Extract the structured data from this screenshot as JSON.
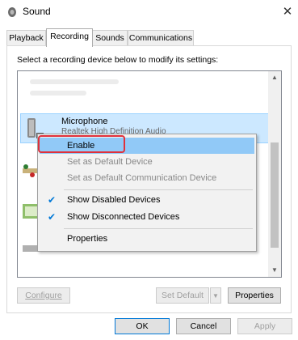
{
  "window": {
    "title": "Sound",
    "icon": "speaker-icon",
    "close": "close-icon"
  },
  "tabs": [
    {
      "label": "Playback"
    },
    {
      "label": "Recording"
    },
    {
      "label": "Sounds"
    },
    {
      "label": "Communications"
    }
  ],
  "instructions": "Select a recording device below to modify its settings:",
  "device": {
    "name": "Microphone",
    "description": "Realtek High Definition Audio"
  },
  "context_menu": {
    "enable": "Enable",
    "set_default": "Set as Default Device",
    "set_default_comm": "Set as Default Communication Device",
    "show_disabled": "Show Disabled Devices",
    "show_disconnected": "Show Disconnected Devices",
    "properties": "Properties"
  },
  "panel_buttons": {
    "configure": "Configure",
    "set_default": "Set Default",
    "properties": "Properties"
  },
  "dialog_buttons": {
    "ok": "OK",
    "cancel": "Cancel",
    "apply": "Apply"
  },
  "colors": {
    "selection": "#cce8ff",
    "menu_hover": "#91c9f7",
    "annotation": "#e0303a",
    "check": "#0078d7"
  }
}
